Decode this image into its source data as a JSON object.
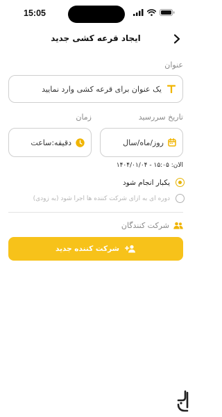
{
  "status_bar": {
    "time": "15:05"
  },
  "header": {
    "title": "ایجاد قرعه کشی جدید"
  },
  "form": {
    "title_label": "عنوان",
    "title_placeholder": "یک عنوان برای قرعه کشی وارد نمایید",
    "date_label": "تاریخ سررسید",
    "date_placeholder": "روز/ماه/سال",
    "time_label": "زمان",
    "time_placeholder": "دقیقه:ساعت",
    "now_text": "الان: ۱۵:۰۵ - ۱۴۰۴/۰۱/۰۴"
  },
  "recurrence": {
    "options": [
      {
        "label": "یکبار انجام شود",
        "selected": true
      },
      {
        "label": "دوره ای به ازای شرکت کننده ها اجرا شود (به زودی)",
        "selected": false
      }
    ]
  },
  "participants": {
    "section_label": "شرکت کنندگان",
    "add_button_label": "شرکت کننده جدید"
  },
  "colors": {
    "accent": "#F7C21A",
    "radio_active": "#E6B300",
    "muted": "#8A8A8A"
  },
  "icons": {
    "back": "chevron-right-icon",
    "title_field": "text-t-icon",
    "date_field": "calendar-icon",
    "time_field": "clock-icon",
    "section": "people-icon",
    "add_button": "add-person-icon",
    "brand": "brand-logo-icon"
  }
}
